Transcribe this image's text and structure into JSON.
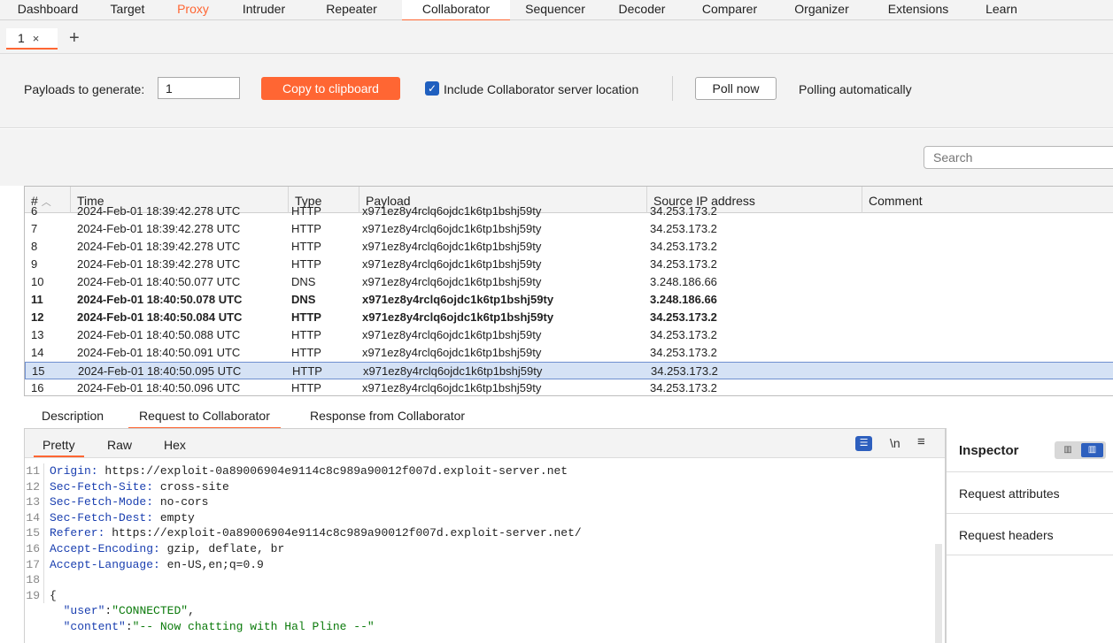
{
  "top_tabs": [
    "Dashboard",
    "Target",
    "Proxy",
    "Intruder",
    "Repeater",
    "Collaborator",
    "Sequencer",
    "Decoder",
    "Comparer",
    "Organizer",
    "Extensions",
    "Learn"
  ],
  "sub_tab": {
    "label": "1",
    "close": "×",
    "add": "+"
  },
  "controls": {
    "payloads_label": "Payloads to generate:",
    "payloads_value": "1",
    "copy_button": "Copy to clipboard",
    "include_label": "Include Collaborator server location",
    "poll_button": "Poll now",
    "polling_status": "Polling automatically"
  },
  "search": {
    "placeholder": "Search"
  },
  "table": {
    "headers": [
      "#",
      "Time",
      "Type",
      "Payload",
      "Source IP address",
      "Comment"
    ],
    "rows": [
      {
        "n": "6",
        "time": "2024-Feb-01 18:39:42.278 UTC",
        "type": "HTTP",
        "payload": "x971ez8y4rclq6ojdc1k6tp1bshj59ty",
        "ip": "34.253.173.2",
        "bold": false
      },
      {
        "n": "7",
        "time": "2024-Feb-01 18:39:42.278 UTC",
        "type": "HTTP",
        "payload": "x971ez8y4rclq6ojdc1k6tp1bshj59ty",
        "ip": "34.253.173.2",
        "bold": false
      },
      {
        "n": "8",
        "time": "2024-Feb-01 18:39:42.278 UTC",
        "type": "HTTP",
        "payload": "x971ez8y4rclq6ojdc1k6tp1bshj59ty",
        "ip": "34.253.173.2",
        "bold": false
      },
      {
        "n": "9",
        "time": "2024-Feb-01 18:39:42.278 UTC",
        "type": "HTTP",
        "payload": "x971ez8y4rclq6ojdc1k6tp1bshj59ty",
        "ip": "34.253.173.2",
        "bold": false
      },
      {
        "n": "10",
        "time": "2024-Feb-01 18:40:50.077 UTC",
        "type": "DNS",
        "payload": "x971ez8y4rclq6ojdc1k6tp1bshj59ty",
        "ip": "3.248.186.66",
        "bold": false
      },
      {
        "n": "11",
        "time": "2024-Feb-01 18:40:50.078 UTC",
        "type": "DNS",
        "payload": "x971ez8y4rclq6ojdc1k6tp1bshj59ty",
        "ip": "3.248.186.66",
        "bold": true
      },
      {
        "n": "12",
        "time": "2024-Feb-01 18:40:50.084 UTC",
        "type": "HTTP",
        "payload": "x971ez8y4rclq6ojdc1k6tp1bshj59ty",
        "ip": "34.253.173.2",
        "bold": true
      },
      {
        "n": "13",
        "time": "2024-Feb-01 18:40:50.088 UTC",
        "type": "HTTP",
        "payload": "x971ez8y4rclq6ojdc1k6tp1bshj59ty",
        "ip": "34.253.173.2",
        "bold": false
      },
      {
        "n": "14",
        "time": "2024-Feb-01 18:40:50.091 UTC",
        "type": "HTTP",
        "payload": "x971ez8y4rclq6ojdc1k6tp1bshj59ty",
        "ip": "34.253.173.2",
        "bold": false
      },
      {
        "n": "15",
        "time": "2024-Feb-01 18:40:50.095 UTC",
        "type": "HTTP",
        "payload": "x971ez8y4rclq6ojdc1k6tp1bshj59ty",
        "ip": "34.253.173.2",
        "bold": false,
        "selected": true
      },
      {
        "n": "16",
        "time": "2024-Feb-01 18:40:50.096 UTC",
        "type": "HTTP",
        "payload": "x971ez8y4rclq6ojdc1k6tp1bshj59ty",
        "ip": "34.253.173.2",
        "bold": false
      }
    ]
  },
  "lower_tabs": [
    "Description",
    "Request to Collaborator",
    "Response from Collaborator"
  ],
  "editor_tabs": [
    "Pretty",
    "Raw",
    "Hex"
  ],
  "editor_icons": {
    "newline": "\\n",
    "menu": "≡"
  },
  "code": {
    "headers": [
      {
        "ln": "11",
        "key": "Origin:",
        "value": " https://exploit-0a89006904e9114c8c989a90012f007d.exploit-server.net"
      },
      {
        "ln": "12",
        "key": "Sec-Fetch-Site:",
        "value": " cross-site"
      },
      {
        "ln": "13",
        "key": "Sec-Fetch-Mode:",
        "value": " no-cors"
      },
      {
        "ln": "14",
        "key": "Sec-Fetch-Dest:",
        "value": " empty"
      },
      {
        "ln": "15",
        "key": "Referer:",
        "value": " https://exploit-0a89006904e9114c8c989a90012f007d.exploit-server.net/"
      },
      {
        "ln": "16",
        "key": "Accept-Encoding:",
        "value": " gzip, deflate, br"
      },
      {
        "ln": "17",
        "key": "Accept-Language:",
        "value": " en-US,en;q=0.9"
      }
    ],
    "ln_empty": "18",
    "ln_open": "19",
    "open_brace": "{",
    "json_user_key": "\"user\"",
    "json_user_val": "\"CONNECTED\"",
    "json_content_key": "\"content\"",
    "json_content_val": "\"-- Now chatting with Hal Pline --\""
  },
  "inspector": {
    "title": "Inspector",
    "sections": [
      "Request attributes",
      "Request headers"
    ]
  },
  "colors": {
    "accent": "#ff6633",
    "selection": "#d5e2f5",
    "header_key": "#1a3fb0",
    "json_string": "#0b7a0b"
  }
}
